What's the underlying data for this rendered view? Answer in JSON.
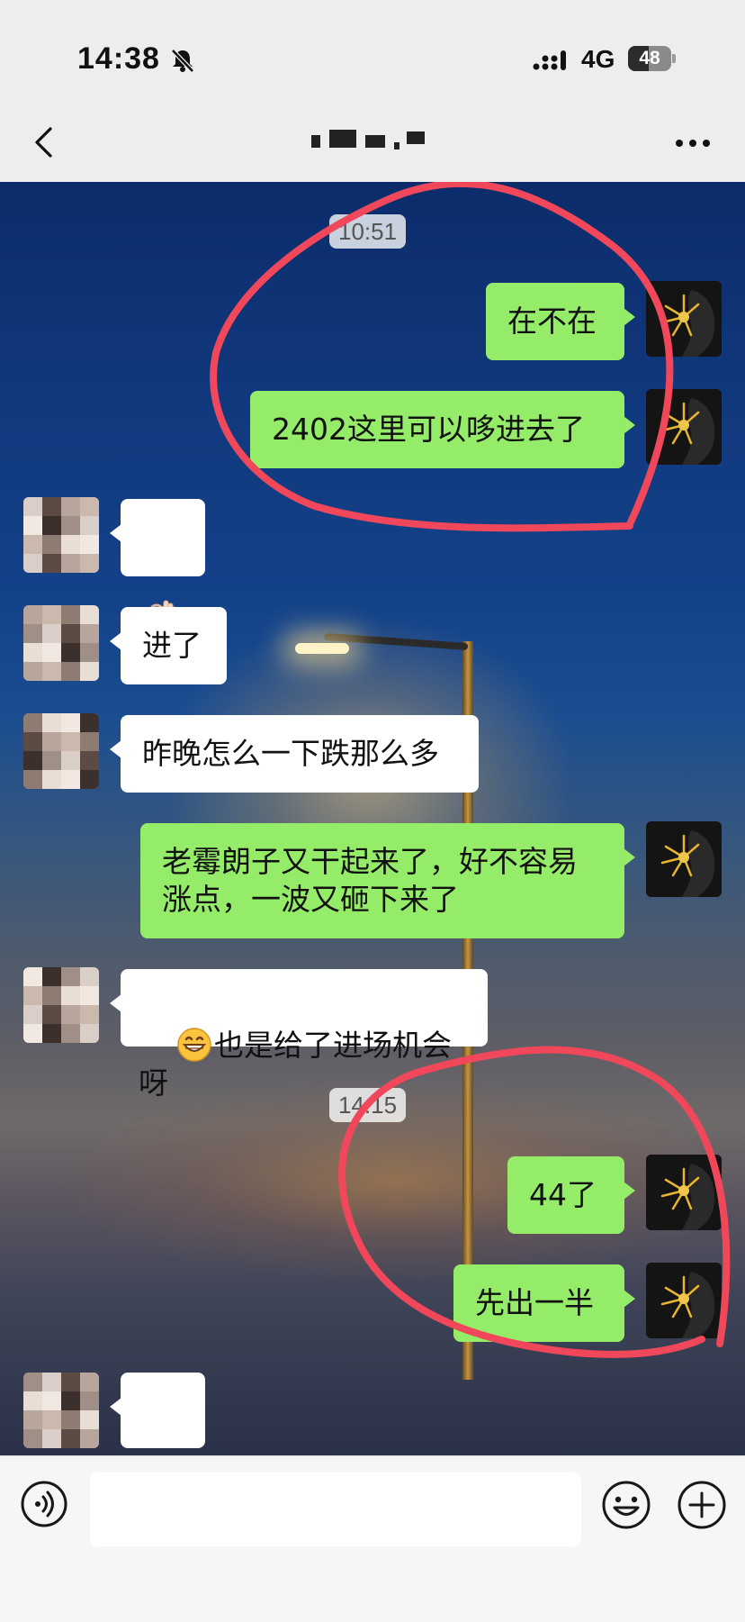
{
  "status_bar": {
    "time": "14:38",
    "network": "4G",
    "battery": "48",
    "battery_level_percent": 48,
    "icons": [
      "bell-slash-icon",
      "signal-icon"
    ]
  },
  "nav": {
    "back_icon": "chevron-left-icon",
    "more_icon": "more-dots-icon",
    "title": ""
  },
  "chat": {
    "timestamps": [
      "10:51",
      "14:15"
    ],
    "messages": [
      {
        "from": "self",
        "text": "在不在"
      },
      {
        "from": "self",
        "text": "2402这里可以哆进去了"
      },
      {
        "from": "other",
        "emoji": "ok-hand-emoji"
      },
      {
        "from": "other",
        "text": "进了"
      },
      {
        "from": "other",
        "text": "昨晚怎么一下跌那么多"
      },
      {
        "from": "self",
        "text": "老霉朗子又干起来了，好不容易\n涨点，一波又砸下来了"
      },
      {
        "from": "other",
        "emoji": "grin-emoji",
        "text": "也是给了进场机会呀"
      },
      {
        "from": "self",
        "text": "44了"
      },
      {
        "from": "self",
        "text": "先出一半"
      },
      {
        "from": "other",
        "emoji": "ok-hand-emoji"
      }
    ],
    "annotation_color": "#f0485a"
  },
  "input_bar": {
    "value": "",
    "icons": [
      "voice-icon",
      "emoji-icon",
      "plus-icon"
    ]
  },
  "colors": {
    "self_bubble": "#95ec69",
    "other_bubble": "#ffffff",
    "bar_bg": "#ededed"
  }
}
